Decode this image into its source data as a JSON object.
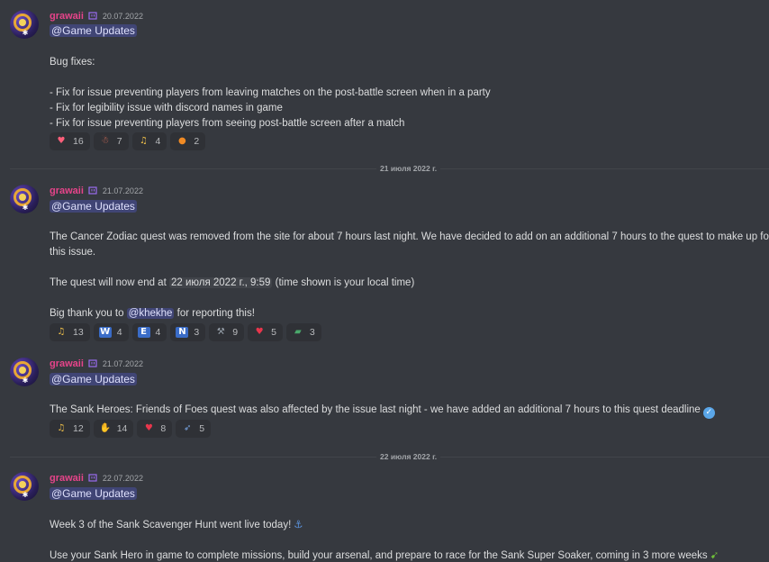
{
  "messages": [
    {
      "author": "grawaii",
      "timestamp": "20.07.2022",
      "role_mention": "@Game Updates",
      "lines": [
        "Bug fixes:",
        "- Fix for issue preventing players from leaving matches on the post-battle screen when in a party",
        "- Fix for legibility issue with discord names in game",
        "- Fix for issue preventing players from seeing post-battle screen after a match"
      ],
      "reactions": [
        {
          "icon": "heart-face-emoji",
          "count": "16"
        },
        {
          "icon": "dancing-figure-emoji",
          "count": "7"
        },
        {
          "icon": "people-celebrating-emoji",
          "count": "4"
        },
        {
          "icon": "orange-ball-emoji",
          "count": "2"
        }
      ]
    },
    {
      "author": "grawaii",
      "timestamp": "21.07.2022",
      "role_mention": "@Game Updates",
      "line1": "The Cancer Zodiac quest was removed from the site for about 7 hours last night. We have decided to add on an additional 7 hours to the quest to make up for",
      "line2": "this issue.",
      "line3_pre": "The quest will now end at ",
      "line3_chip": "22 июля 2022 г., 9:59",
      "line3_post": " (time shown is your local time)",
      "line4_pre": "Big thank you to ",
      "line4_mention": "@khekhe",
      "line4_post": " for reporting this!",
      "reactions": [
        {
          "icon": "people-celebrating-emoji",
          "label": "",
          "count": "13"
        },
        {
          "icon": "letter-w-emoji",
          "label": "W",
          "count": "4"
        },
        {
          "icon": "letter-e-emoji",
          "label": "E",
          "count": "4"
        },
        {
          "icon": "letter-n-emoji",
          "label": "N",
          "count": "3"
        },
        {
          "icon": "wrench-emoji",
          "label": "",
          "count": "9"
        },
        {
          "icon": "red-heart-emoji",
          "label": "",
          "count": "5"
        },
        {
          "icon": "map-emoji",
          "label": "",
          "count": "3"
        }
      ]
    },
    {
      "author": "grawaii",
      "timestamp": "21.07.2022",
      "role_mention": "@Game Updates",
      "line1": "The Sank Heroes: Friends of Foes quest was also affected by the issue last night - we have added an additional 7 hours to this quest deadline",
      "reactions": [
        {
          "icon": "people-celebrating-emoji",
          "count": "12"
        },
        {
          "icon": "thumbs-up-emoji",
          "count": "14"
        },
        {
          "icon": "red-heart-emoji",
          "count": "8"
        },
        {
          "icon": "rocket-emoji",
          "count": "5"
        }
      ]
    },
    {
      "author": "grawaii",
      "timestamp": "22.07.2022",
      "role_mention": "@Game Updates",
      "line1": "Week 3 of the Sank Scavenger Hunt went live today!",
      "line2": "Use your Sank Hero in game to complete missions, build your arsenal, and prepare to race for the Sank Super Soaker, coming in 3 more weeks"
    }
  ],
  "dividers": {
    "first": "21 июля 2022 г.",
    "second": "22 июля 2022 г."
  },
  "colors": {
    "background": "#36393f",
    "author": "#e6448a",
    "mention_bg": "#5865f2",
    "reaction_bg": "#2f3136"
  }
}
